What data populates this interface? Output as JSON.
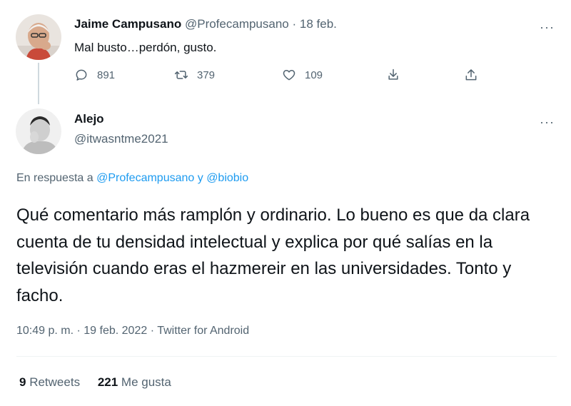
{
  "tweet1": {
    "author_name": "Jaime Campusano",
    "author_handle": "@Profecampusano",
    "separator": "·",
    "date": "18 feb.",
    "text": "Mal busto…perdón, gusto.",
    "more_label": "···",
    "actions": {
      "reply_count": "891",
      "retweet_count": "379",
      "like_count": "109"
    },
    "icons": [
      "reply-icon",
      "retweet-icon",
      "like-icon",
      "download-icon",
      "share-icon"
    ]
  },
  "tweet2": {
    "author_name": "Alejo",
    "author_handle": "@itwasntme2021",
    "more_label": "···",
    "reply_prefix": "En respuesta a",
    "reply_user1": "@Profecampusano",
    "reply_conjunction": "y",
    "reply_user2": "@biobio",
    "text": "Qué comentario más ramplón y ordinario. Lo bueno es que da clara cuenta de tu densidad intelectual y explica por qué salías en la televisión cuando eras el hazmereir en las universidades. Tonto y facho.",
    "time": "10:49 p. m.",
    "date": "19 feb. 2022",
    "source": "Twitter for Android",
    "separator": "·",
    "retweets_count": "9",
    "retweets_label": "Retweets",
    "likes_count": "221",
    "likes_label": "Me gusta"
  },
  "colors": {
    "link": "#1d9bf0",
    "muted": "#536471",
    "text": "#0f1419"
  }
}
